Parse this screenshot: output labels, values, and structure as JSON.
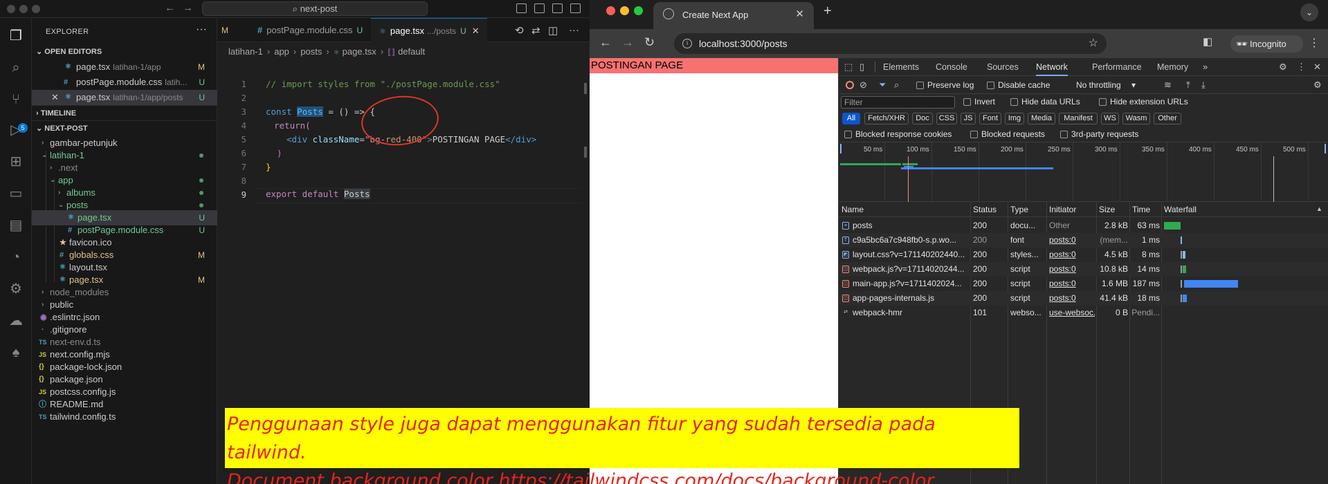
{
  "vscode": {
    "search": "next-post",
    "explorer_title": "EXPLORER",
    "sections": {
      "open_editors": "OPEN EDITORS",
      "timeline": "TIMELINE",
      "project": "NEXT-POST"
    },
    "open_editors": [
      {
        "name": "page.tsx",
        "path": "latihan-1/app",
        "status": "M"
      },
      {
        "name": "postPage.module.css",
        "path": "latih...",
        "status": "U"
      },
      {
        "name": "page.tsx",
        "path": "latihan-1/app/posts",
        "status": "U"
      }
    ],
    "tree": {
      "gambar_petunjuk": "gambar-petunjuk",
      "latihan_1": "latihan-1",
      "next": ".next",
      "app": "app",
      "albums": "albums",
      "posts": "posts",
      "posts_page": "page.tsx",
      "posts_page_status": "U",
      "posts_css": "postPage.module.css",
      "posts_css_status": "U",
      "favicon": "favicon.ico",
      "globals": "globals.css",
      "globals_status": "M",
      "layout": "layout.tsx",
      "app_page": "page.tsx",
      "app_page_status": "M",
      "node_modules": "node_modules",
      "public": "public",
      "eslintrc": ".eslintrc.json",
      "gitignore": ".gitignore",
      "next_env": "next-env.d.ts",
      "next_config": "next.config.mjs",
      "package_lock": "package-lock.json",
      "package": "package.json",
      "postcss": "postcss.config.js",
      "readme": "README.md",
      "tailwind": "tailwind.config.ts"
    },
    "tabs": {
      "first": "M",
      "second": "postPage.module.css",
      "second_status": "U",
      "active": "page.tsx",
      "active_path": ".../posts",
      "active_status": "U"
    },
    "breadcrumb": [
      "latihan-1",
      "app",
      "posts",
      "page.tsx",
      "default"
    ],
    "line_numbers": [
      "1",
      "2",
      "3",
      "4",
      "5",
      "6",
      "7",
      "8",
      "9"
    ],
    "code": {
      "l1": "// import styles from \"./postPage.module.css\"",
      "l3_kw": "const",
      "l3_name": "Posts",
      "l3_rest": " = () => {",
      "l4": "return(",
      "l5_tag_open": "<div",
      "l5_attr": "className",
      "l5_eq": "=",
      "l5_val": "\"bg-red-400\"",
      "l5_gt": ">",
      "l5_text": "POSTINGAN PAGE",
      "l5_close": "</div>",
      "l6": ")",
      "l7": "}",
      "l9_kw": "export default",
      "l9_name": "Posts"
    }
  },
  "chrome": {
    "tab_title": "Create Next App",
    "url": "localhost:3000/posts",
    "incognito": "Incognito",
    "page_text": "POSTINGAN PAGE"
  },
  "devtools": {
    "tabs": [
      "Elements",
      "Console",
      "Sources",
      "Network",
      "Performance",
      "Memory"
    ],
    "active_tab": "Network",
    "toolbar": {
      "preserve_log": "Preserve log",
      "disable_cache": "Disable cache",
      "throttling": "No throttling"
    },
    "filter_placeholder": "Filter",
    "filter_opts": {
      "invert": "Invert",
      "hide_data": "Hide data URLs",
      "hide_ext": "Hide extension URLs"
    },
    "types": [
      "All",
      "Fetch/XHR",
      "Doc",
      "CSS",
      "JS",
      "Font",
      "Img",
      "Media",
      "Manifest",
      "WS",
      "Wasm",
      "Other"
    ],
    "blocked": {
      "cookies": "Blocked response cookies",
      "requests": "Blocked requests",
      "third_party": "3rd-party requests"
    },
    "overview_ticks": [
      "50 ms",
      "100 ms",
      "150 ms",
      "200 ms",
      "250 ms",
      "300 ms",
      "350 ms",
      "400 ms",
      "450 ms",
      "500 ms"
    ],
    "columns": [
      "Name",
      "Status",
      "Type",
      "Initiator",
      "Size",
      "Time",
      "Waterfall"
    ],
    "rows": [
      {
        "name": "posts",
        "status": "200",
        "type": "docu...",
        "initiator": "Other",
        "size": "2.8 kB",
        "time": "63 ms",
        "icon": "doc-icon",
        "color": "#34a853"
      },
      {
        "name": "c9a5bc6a7c948fb0-s.p.wo...",
        "status": "200",
        "type": "font",
        "initiator": "posts:0",
        "size": "(mem...",
        "time": "1 ms",
        "icon": "font-icon",
        "color": "#8ab4f8"
      },
      {
        "name": "layout.css?v=171140202440...",
        "status": "200",
        "type": "styles...",
        "initiator": "posts:0",
        "size": "4.5 kB",
        "time": "8 ms",
        "icon": "css-icon",
        "color": "#8ab4f8"
      },
      {
        "name": "webpack.js?v=17114020244...",
        "status": "200",
        "type": "script",
        "initiator": "posts:0",
        "size": "10.8 kB",
        "time": "14 ms",
        "icon": "js-icon",
        "color": "#34a853"
      },
      {
        "name": "main-app.js?v=1711402024...",
        "status": "200",
        "type": "script",
        "initiator": "posts:0",
        "size": "1.6 MB",
        "time": "187 ms",
        "icon": "js-icon",
        "color": "#4285f4"
      },
      {
        "name": "app-pages-internals.js",
        "status": "200",
        "type": "script",
        "initiator": "posts:0",
        "size": "41.4 kB",
        "time": "18 ms",
        "icon": "js-icon",
        "color": "#4285f4"
      },
      {
        "name": "webpack-hmr",
        "status": "101",
        "type": "webso...",
        "initiator": "use-websoc...",
        "size": "0 B",
        "time": "Pendi...",
        "icon": "ws-icon",
        "color": ""
      }
    ]
  },
  "caption": {
    "line1": "Penggunaan style juga dapat menggunakan fitur yang sudah tersedia pada tailwind.",
    "line2": "Document background color https://tailwindcss.com/docs/background-color"
  }
}
